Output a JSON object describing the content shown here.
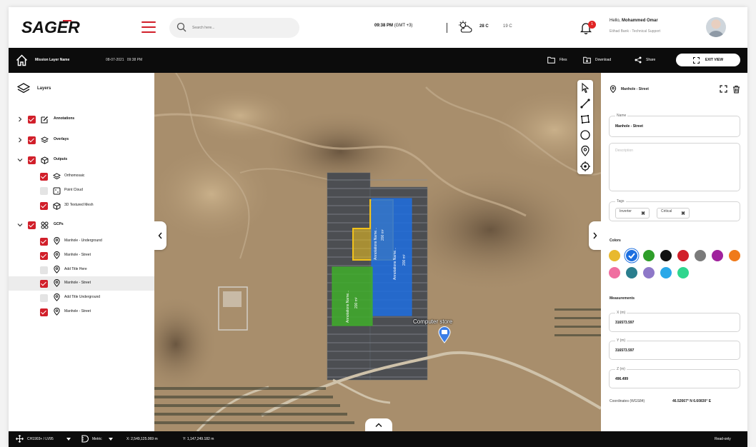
{
  "header": {
    "brand": "SAGER",
    "search_placeholder": "Search here...",
    "time": "09:38 PM",
    "timezone": "(GMT +3)",
    "weather_icon": "cloud-sun-icon",
    "temp_high": "28 C",
    "temp_low": "19 C",
    "notification_count": "1",
    "greeting_prefix": "Hello,",
    "user_name": "Mohammed Omar",
    "user_role": "Etihad Bank - Technical Support"
  },
  "toolbar": {
    "mission_name": "Mission Layer Name",
    "mission_date": "08-07-2021",
    "mission_time": "09:38 PM",
    "files_label": "Files",
    "download_label": "Download",
    "share_label": "Share",
    "exit_label": "EXIT VIEW"
  },
  "layers": {
    "title": "Layers",
    "groups": [
      {
        "label": "Annotations",
        "checked": true
      },
      {
        "label": "Overlays",
        "checked": true
      },
      {
        "label": "Outputs",
        "checked": true
      },
      {
        "label": "GCPs",
        "checked": true
      }
    ],
    "outputs": [
      {
        "label": "Orthomosaic",
        "checked": true
      },
      {
        "label": "Point Cloud",
        "checked": false
      },
      {
        "label": "3D Textured Mesh",
        "checked": true
      }
    ],
    "gcps": [
      {
        "label": "Manhole - Underground",
        "checked": true
      },
      {
        "label": "Manhole - Street",
        "checked": true
      },
      {
        "label": "Add Title Here",
        "checked": false
      },
      {
        "label": "Manhole - Street",
        "checked": true,
        "selected": true
      },
      {
        "label": "Add Title Underground",
        "checked": false
      },
      {
        "label": "Manhole - Street",
        "checked": true
      }
    ]
  },
  "map": {
    "poi_label": "Computer store",
    "annotations": [
      {
        "label": "Annotations Name...",
        "area": "200 m²",
        "color": "#f2c21b"
      },
      {
        "label": "Annotations Name...",
        "area": "200 m²",
        "color": "#1f6fe0"
      },
      {
        "label": "Annotations Name...",
        "area": "200 m²",
        "color": "#3fae2a"
      }
    ]
  },
  "details": {
    "title": "Manhole - Street",
    "name_label": "Name",
    "name_value": "Manhole - Street",
    "description_placeholder": "Description",
    "tags_label": "Tags",
    "tags": [
      "Inverter",
      "Critical"
    ],
    "colors_label": "Colors",
    "colors": [
      "#e8b92e",
      "#1c6fe0",
      "#2f9e2a",
      "#111111",
      "#d11f2a",
      "#7a7a7a",
      "#a0229d",
      "#f07a1a",
      "#f06ea0",
      "#2a7e8e",
      "#8e78c8",
      "#2aa8e8",
      "#2fd68e"
    ],
    "selected_color": 1,
    "measurements_label": "Measurements",
    "x_label": "X (m)",
    "x_value": "316573.597",
    "y_label": "Y (m)",
    "y_value": "316573.597",
    "z_label": "Z (m)",
    "z_value": "496.499",
    "coords_label": "Coordinates (WGS84)",
    "coords_value": "46.52667° N 6.60830° E"
  },
  "statusbar": {
    "crs": "CH1903+ / LV95",
    "units": "Metric",
    "x": "X: 2,549,125.069 m",
    "y": "Y: 1,147,249.182 m",
    "mode": "Read-only"
  }
}
